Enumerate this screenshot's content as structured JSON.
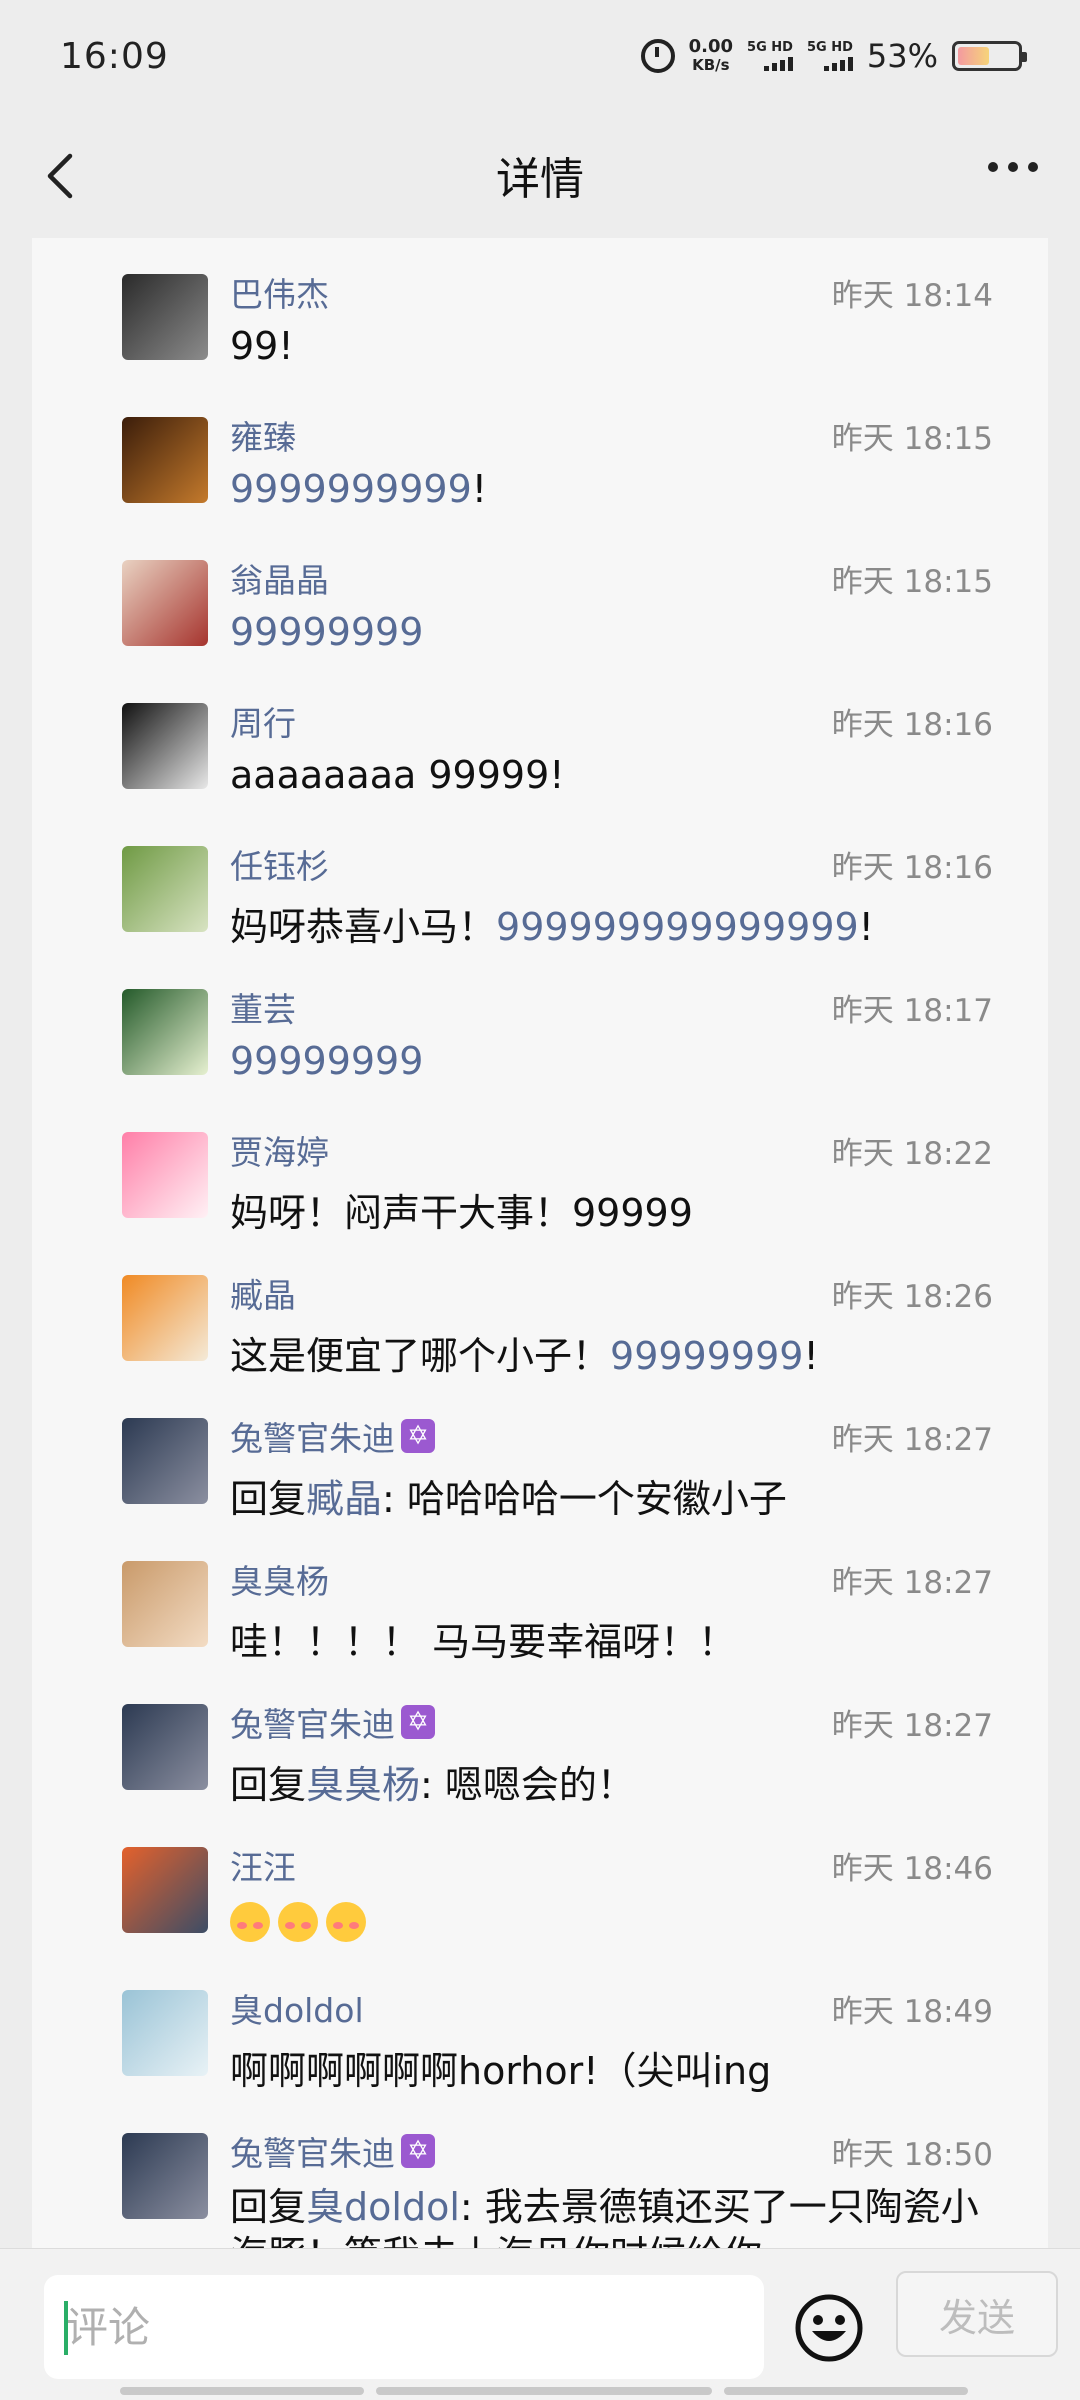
{
  "status_bar": {
    "time": "16:09",
    "net_speed_value": "0.00",
    "net_speed_unit": "KB/s",
    "sim1": "5G HD",
    "sim2": "5G HD",
    "battery_percent": "53%",
    "battery_level": 0.53
  },
  "header": {
    "title": "详情"
  },
  "comments": [
    {
      "name": "巴伟杰",
      "time": "昨天 18:14",
      "parts": [
        {
          "t": "99!",
          "hl": false
        }
      ],
      "avatar_colors": [
        "#2a2a2a",
        "#8c8c8c"
      ]
    },
    {
      "name": "雍臻",
      "time": "昨天 18:15",
      "parts": [
        {
          "t": "9999999999",
          "hl": true
        },
        {
          "t": "!",
          "hl": false
        }
      ],
      "avatar_colors": [
        "#3b1d0a",
        "#c47a2c"
      ]
    },
    {
      "name": "翁晶晶",
      "time": "昨天 18:15",
      "parts": [
        {
          "t": "99999999",
          "hl": true
        }
      ],
      "avatar_colors": [
        "#e9d2c2",
        "#a6342e"
      ]
    },
    {
      "name": "周行",
      "time": "昨天 18:16",
      "parts": [
        {
          "t": "aaaaaaaa 99999!",
          "hl": false
        }
      ],
      "avatar_colors": [
        "#111111",
        "#e8e8e8"
      ]
    },
    {
      "name": "任钰杉",
      "time": "昨天 18:16",
      "parts": [
        {
          "t": "妈呀恭喜小马！",
          "hl": false
        },
        {
          "t": "999999999999999",
          "hl": true
        },
        {
          "t": "!",
          "hl": false
        }
      ],
      "avatar_colors": [
        "#6f9a44",
        "#d8e3c2"
      ]
    },
    {
      "name": "董芸",
      "time": "昨天 18:17",
      "parts": [
        {
          "t": "99999999",
          "hl": true
        }
      ],
      "avatar_colors": [
        "#245a2a",
        "#e6f0d0"
      ]
    },
    {
      "name": "贾海婷",
      "time": "昨天 18:22",
      "parts": [
        {
          "t": "妈呀！闷声干大事！99999",
          "hl": false
        }
      ],
      "avatar_colors": [
        "#ff7fa8",
        "#fff1f5"
      ]
    },
    {
      "name": "臧晶",
      "time": "昨天 18:26",
      "parts": [
        {
          "t": "这是便宜了哪个小子！",
          "hl": false
        },
        {
          "t": "99999999",
          "hl": true
        },
        {
          "t": "!",
          "hl": false
        }
      ],
      "avatar_colors": [
        "#f08a24",
        "#f4ead8"
      ]
    },
    {
      "name": "兔警官朱迪",
      "badge": "✡",
      "time": "昨天 18:27",
      "parts": [
        {
          "t": "回复",
          "hl": false
        },
        {
          "t": "臧晶",
          "hl": true
        },
        {
          "t": ": 哈哈哈哈一个安徽小子",
          "hl": false
        }
      ],
      "avatar_colors": [
        "#2c3a52",
        "#8b8fa0"
      ]
    },
    {
      "name": "臭臭杨",
      "time": "昨天 18:27",
      "parts": [
        {
          "t": "哇！！！！ 马马要幸福呀！！",
          "hl": false
        }
      ],
      "avatar_colors": [
        "#c99a6a",
        "#f3dcc4"
      ]
    },
    {
      "name": "兔警官朱迪",
      "badge": "✡",
      "time": "昨天 18:27",
      "parts": [
        {
          "t": "回复",
          "hl": false
        },
        {
          "t": "臭臭杨",
          "hl": true
        },
        {
          "t": ": 嗯嗯会的！",
          "hl": false
        }
      ],
      "avatar_colors": [
        "#2c3a52",
        "#8b8fa0"
      ]
    },
    {
      "name": "汪汪",
      "time": "昨天 18:46",
      "emoji_count": 3,
      "parts": [],
      "avatar_colors": [
        "#e4612c",
        "#3c4d66"
      ]
    },
    {
      "name": "臭doldol",
      "time": "昨天 18:49",
      "parts": [
        {
          "t": "啊啊啊啊啊啊horhor!（尖叫ing",
          "hl": false
        }
      ],
      "avatar_colors": [
        "#9ac3d6",
        "#e8f2f6"
      ]
    },
    {
      "name": "兔警官朱迪",
      "badge": "✡",
      "time": "昨天 18:50",
      "wrap": true,
      "parts": [
        {
          "t": "回复",
          "hl": false
        },
        {
          "t": "臭doldol",
          "hl": true
        },
        {
          "t": ": 我去景德镇还买了一只陶瓷小海豚！等我去上海见你时候给你",
          "hl": false
        }
      ],
      "avatar_colors": [
        "#2c3a52",
        "#8b8fa0"
      ]
    }
  ],
  "input_bar": {
    "placeholder": "评论",
    "send_label": "发送"
  },
  "icons": {
    "back": "chevron-left-icon",
    "more": "more-dots-icon",
    "emoji": "smiley-icon",
    "alarm": "alarm-icon"
  },
  "colors": {
    "link": "#576b95",
    "background": "#ededed",
    "panel": "#f7f7f7"
  }
}
